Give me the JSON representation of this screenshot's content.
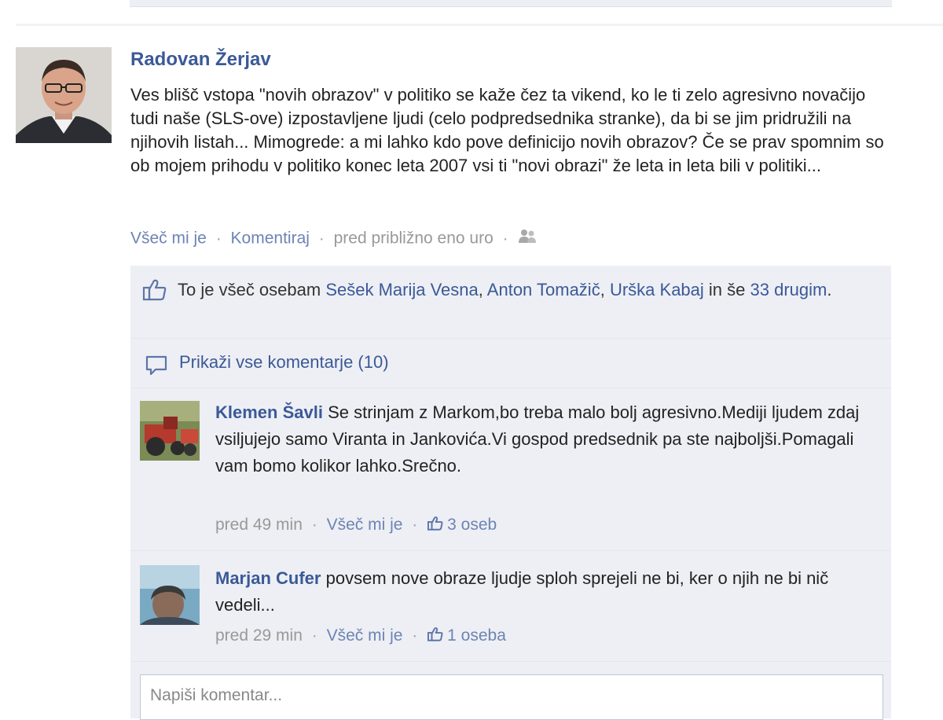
{
  "post": {
    "author": "Radovan Žerjav",
    "text": "Ves blišč vstopa \"novih obrazov\" v politiko se kaže čez ta vikend, ko le ti zelo agresivno novačijo tudi naše (SLS-ove) izpostavljene ljudi (celo podpredsednika stranke), da bi se jim pridružili na njihovih listah... Mimogrede: a mi lahko kdo pove definicijo novih obrazov? Če se prav spomnim so ob mojem prihodu v politiko konec leta 2007 vsi ti \"novi obrazi\" že leta in leta bili v politiki...",
    "like_label": "Všeč mi je",
    "comment_label": "Komentiraj",
    "timestamp": "pred približno eno uro",
    "separator": "·"
  },
  "likes": {
    "prefix": "To je všeč osebam",
    "people": [
      "Sešek Marija Vesna",
      "Anton Tomažič",
      "Urška Kabaj"
    ],
    "comma": ",",
    "and_more": "in še",
    "others_link": "33 drugim",
    "suffix": "."
  },
  "comments_link": "Prikaži vse komentarje (10)",
  "comments": [
    {
      "author": "Klemen Šavli",
      "text": "Se strinjam z Markom,bo treba malo bolj agresivno.Mediji ljudem zdaj vsiljujejo samo Viranta in Jankovića.Vi gospod predsednik pa ste najboljši.Pomagali vam bomo kolikor lahko.Srečno.",
      "time": "pred 49 min",
      "like_label": "Všeč mi je",
      "like_count": "3 oseb"
    },
    {
      "author": "Marjan Cufer",
      "text": "povsem nove obraze ljudje sploh sprejeli ne bi, ker o njih ne bi nič vedeli...",
      "time": "pred 29 min",
      "like_label": "Všeč mi je",
      "like_count": "1 oseba"
    }
  ],
  "composer": {
    "placeholder": "Napiši komentar..."
  },
  "icons": {
    "like": "thumbs-up-icon",
    "comment": "speech-bubble-icon",
    "audience": "friends-audience-icon"
  },
  "colors": {
    "link": "#3b5998",
    "feedback_bg": "#edeff4",
    "meta": "#999999"
  }
}
